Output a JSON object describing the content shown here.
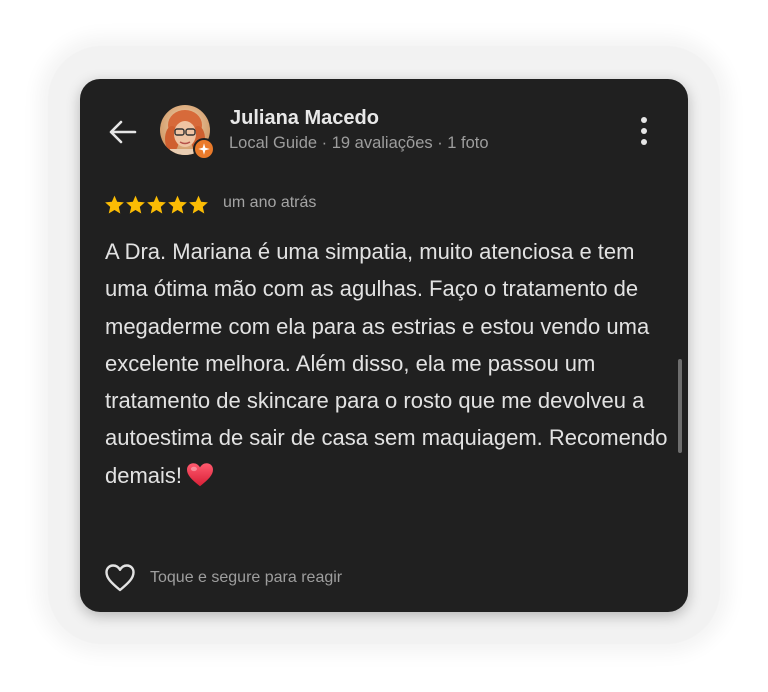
{
  "reviewer": {
    "name": "Juliana Macedo",
    "meta": "Local Guide · 19 avaliações · 1 foto",
    "avatar_icon": "reviewer-photo",
    "badge_icon": "local-guide-badge"
  },
  "rating": {
    "stars": 5,
    "max_stars": 5,
    "star_color": "#fbbc04",
    "time_ago": "um ano atrás"
  },
  "review": {
    "text": "A Dra. Mariana é uma simpatia, muito atenciosa e tem uma ótima mão com as agulhas. Faço o tratamento de megaderme com ela para as estrias e estou vendo uma excelente melhora. Além disso, ela me passou um tratamento de skincare para o rosto que me devolveu a autoestima de sair de casa sem maquiagem. Recomendo demais!",
    "emoji": "red-heart-emoji"
  },
  "actions": {
    "back_icon": "back-arrow-icon",
    "more_icon": "more-vert-icon",
    "react_icon": "heart-outline-icon",
    "react_label": "Toque e segure para reagir"
  },
  "colors": {
    "card_background": "#202020",
    "text_primary": "#e2e2e2",
    "text_secondary": "#9e9e9e",
    "badge": "#ea7a2a",
    "heart": "#e0243a"
  }
}
